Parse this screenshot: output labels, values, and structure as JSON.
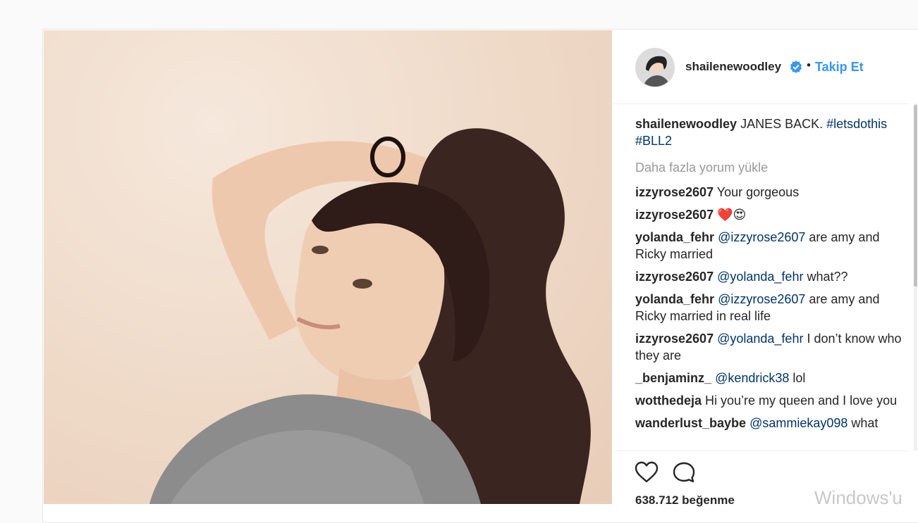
{
  "post": {
    "username": "shailenewoodley",
    "separator": "•",
    "follow_label": "Takip Et",
    "caption": {
      "username": "shailenewoodley",
      "text": "JANES BACK. ",
      "tag1": "#letsdothis",
      "tag2": "#BLL2"
    },
    "load_more": "Daha fazla yorum yükle",
    "likes": "638.712 beğenme"
  },
  "comments": [
    {
      "user": "izzyrose2607",
      "mention": "",
      "text": "Your gorgeous"
    },
    {
      "user": "izzyrose2607",
      "mention": "",
      "text": "❤️😍"
    },
    {
      "user": "yolanda_fehr",
      "mention": "@izzyrose2607",
      "text": " are amy and Ricky married"
    },
    {
      "user": "izzyrose2607",
      "mention": "@yolanda_fehr",
      "text": " what??"
    },
    {
      "user": "yolanda_fehr",
      "mention": "@izzyrose2607",
      "text": " are amy and Ricky married in real life"
    },
    {
      "user": "izzyrose2607",
      "mention": "@yolanda_fehr",
      "text": " I don’t know who they are"
    },
    {
      "user": "_benjaminz_",
      "mention": "@kendrick38",
      "text": " lol"
    },
    {
      "user": "wotthedeja",
      "mention": "",
      "text": "Hi you’re my queen and I love you"
    },
    {
      "user": "wanderlust_baybe",
      "mention": "@sammiekay098",
      "text": " what "
    }
  ],
  "watermark": "Windows'u",
  "colors": {
    "link": "#3897f0",
    "tag": "#003569",
    "muted": "#999999"
  }
}
